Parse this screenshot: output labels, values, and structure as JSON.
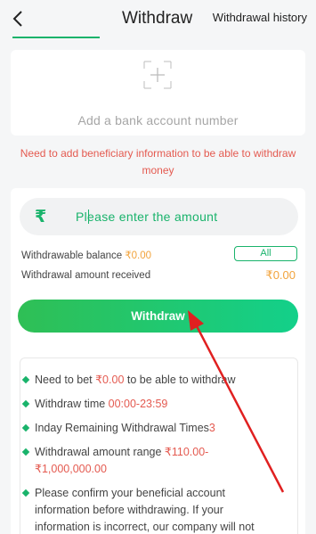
{
  "header": {
    "title": "Withdraw",
    "history_link": "Withdrawal history"
  },
  "bank": {
    "add_label": "Add a bank account number"
  },
  "warning": "Need to add beneficiary information to be able to withdraw money",
  "amount": {
    "currency_symbol": "₹",
    "placeholder": "Please enter the amount"
  },
  "balance": {
    "withdrawable_label": "Withdrawable balance ",
    "withdrawable_value": "₹0.00",
    "all_label": "All",
    "received_label": "Withdrawal amount received",
    "received_value": "₹0.00"
  },
  "withdraw_button": "Withdraw",
  "notes": {
    "n1_prefix": "Need to bet ",
    "n1_value": "₹0.00",
    "n1_suffix": " to be able to withdraw",
    "n2_prefix": "Withdraw time ",
    "n2_value": "00:00-23:59",
    "n3_prefix": "Inday Remaining Withdrawal Times",
    "n3_value": "3",
    "n4_prefix": "Withdrawal amount range ",
    "n4_value_a": "₹110.00-",
    "n4_value_b": "₹1,000,000.00",
    "n5_line1": "Please confirm your beneficial account",
    "n5_line2": "information before withdrawing. If your",
    "n5_line3": "information is incorrect, our company will not"
  },
  "colors": {
    "accent": "#19b36b",
    "warning": "#e45a50",
    "value": "#f2a33c",
    "annotation_arrow": "#e02020"
  }
}
